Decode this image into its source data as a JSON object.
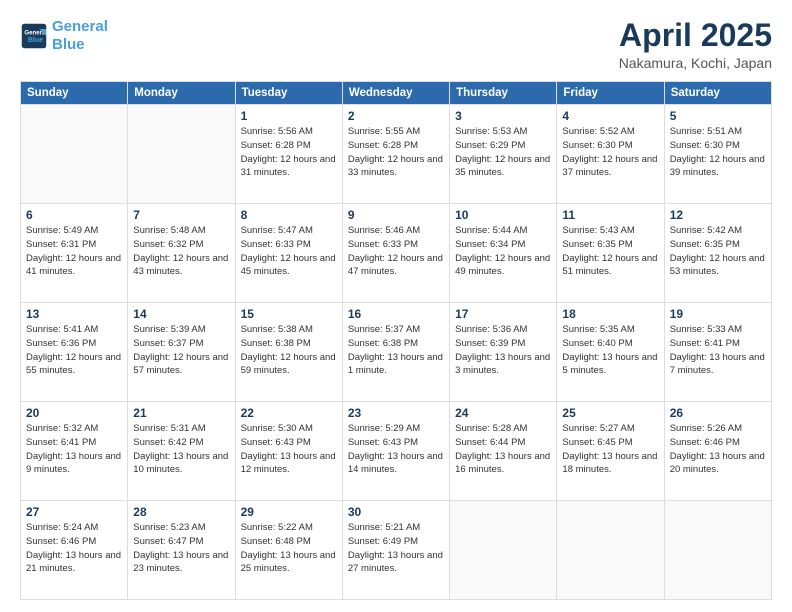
{
  "logo": {
    "line1": "General",
    "line2": "Blue"
  },
  "title": "April 2025",
  "subtitle": "Nakamura, Kochi, Japan",
  "days_header": [
    "Sunday",
    "Monday",
    "Tuesday",
    "Wednesday",
    "Thursday",
    "Friday",
    "Saturday"
  ],
  "weeks": [
    [
      {
        "num": "",
        "info": ""
      },
      {
        "num": "",
        "info": ""
      },
      {
        "num": "1",
        "info": "Sunrise: 5:56 AM\nSunset: 6:28 PM\nDaylight: 12 hours\nand 31 minutes."
      },
      {
        "num": "2",
        "info": "Sunrise: 5:55 AM\nSunset: 6:28 PM\nDaylight: 12 hours\nand 33 minutes."
      },
      {
        "num": "3",
        "info": "Sunrise: 5:53 AM\nSunset: 6:29 PM\nDaylight: 12 hours\nand 35 minutes."
      },
      {
        "num": "4",
        "info": "Sunrise: 5:52 AM\nSunset: 6:30 PM\nDaylight: 12 hours\nand 37 minutes."
      },
      {
        "num": "5",
        "info": "Sunrise: 5:51 AM\nSunset: 6:30 PM\nDaylight: 12 hours\nand 39 minutes."
      }
    ],
    [
      {
        "num": "6",
        "info": "Sunrise: 5:49 AM\nSunset: 6:31 PM\nDaylight: 12 hours\nand 41 minutes."
      },
      {
        "num": "7",
        "info": "Sunrise: 5:48 AM\nSunset: 6:32 PM\nDaylight: 12 hours\nand 43 minutes."
      },
      {
        "num": "8",
        "info": "Sunrise: 5:47 AM\nSunset: 6:33 PM\nDaylight: 12 hours\nand 45 minutes."
      },
      {
        "num": "9",
        "info": "Sunrise: 5:46 AM\nSunset: 6:33 PM\nDaylight: 12 hours\nand 47 minutes."
      },
      {
        "num": "10",
        "info": "Sunrise: 5:44 AM\nSunset: 6:34 PM\nDaylight: 12 hours\nand 49 minutes."
      },
      {
        "num": "11",
        "info": "Sunrise: 5:43 AM\nSunset: 6:35 PM\nDaylight: 12 hours\nand 51 minutes."
      },
      {
        "num": "12",
        "info": "Sunrise: 5:42 AM\nSunset: 6:35 PM\nDaylight: 12 hours\nand 53 minutes."
      }
    ],
    [
      {
        "num": "13",
        "info": "Sunrise: 5:41 AM\nSunset: 6:36 PM\nDaylight: 12 hours\nand 55 minutes."
      },
      {
        "num": "14",
        "info": "Sunrise: 5:39 AM\nSunset: 6:37 PM\nDaylight: 12 hours\nand 57 minutes."
      },
      {
        "num": "15",
        "info": "Sunrise: 5:38 AM\nSunset: 6:38 PM\nDaylight: 12 hours\nand 59 minutes."
      },
      {
        "num": "16",
        "info": "Sunrise: 5:37 AM\nSunset: 6:38 PM\nDaylight: 13 hours\nand 1 minute."
      },
      {
        "num": "17",
        "info": "Sunrise: 5:36 AM\nSunset: 6:39 PM\nDaylight: 13 hours\nand 3 minutes."
      },
      {
        "num": "18",
        "info": "Sunrise: 5:35 AM\nSunset: 6:40 PM\nDaylight: 13 hours\nand 5 minutes."
      },
      {
        "num": "19",
        "info": "Sunrise: 5:33 AM\nSunset: 6:41 PM\nDaylight: 13 hours\nand 7 minutes."
      }
    ],
    [
      {
        "num": "20",
        "info": "Sunrise: 5:32 AM\nSunset: 6:41 PM\nDaylight: 13 hours\nand 9 minutes."
      },
      {
        "num": "21",
        "info": "Sunrise: 5:31 AM\nSunset: 6:42 PM\nDaylight: 13 hours\nand 10 minutes."
      },
      {
        "num": "22",
        "info": "Sunrise: 5:30 AM\nSunset: 6:43 PM\nDaylight: 13 hours\nand 12 minutes."
      },
      {
        "num": "23",
        "info": "Sunrise: 5:29 AM\nSunset: 6:43 PM\nDaylight: 13 hours\nand 14 minutes."
      },
      {
        "num": "24",
        "info": "Sunrise: 5:28 AM\nSunset: 6:44 PM\nDaylight: 13 hours\nand 16 minutes."
      },
      {
        "num": "25",
        "info": "Sunrise: 5:27 AM\nSunset: 6:45 PM\nDaylight: 13 hours\nand 18 minutes."
      },
      {
        "num": "26",
        "info": "Sunrise: 5:26 AM\nSunset: 6:46 PM\nDaylight: 13 hours\nand 20 minutes."
      }
    ],
    [
      {
        "num": "27",
        "info": "Sunrise: 5:24 AM\nSunset: 6:46 PM\nDaylight: 13 hours\nand 21 minutes."
      },
      {
        "num": "28",
        "info": "Sunrise: 5:23 AM\nSunset: 6:47 PM\nDaylight: 13 hours\nand 23 minutes."
      },
      {
        "num": "29",
        "info": "Sunrise: 5:22 AM\nSunset: 6:48 PM\nDaylight: 13 hours\nand 25 minutes."
      },
      {
        "num": "30",
        "info": "Sunrise: 5:21 AM\nSunset: 6:49 PM\nDaylight: 13 hours\nand 27 minutes."
      },
      {
        "num": "",
        "info": ""
      },
      {
        "num": "",
        "info": ""
      },
      {
        "num": "",
        "info": ""
      }
    ]
  ]
}
